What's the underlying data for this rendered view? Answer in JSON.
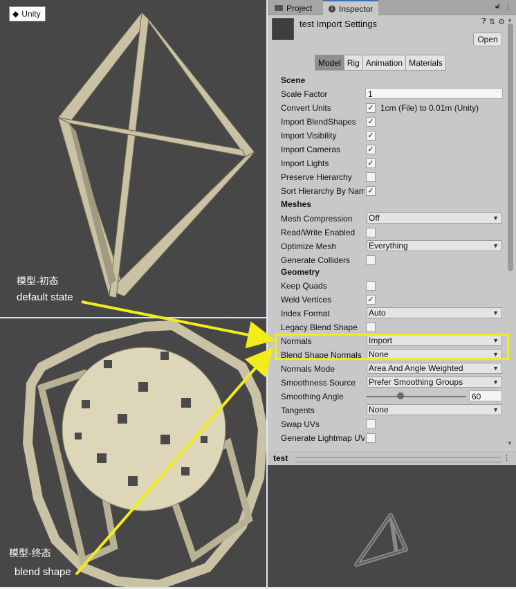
{
  "scene_view": {
    "badge": "Unity",
    "top_label_cn": "模型-初态",
    "top_label_en": "default state",
    "bottom_label_cn": "模型-终态",
    "bottom_label_en": "blend shape"
  },
  "tabs": [
    {
      "label": "Project",
      "icon": "folder-icon"
    },
    {
      "label": "Inspector",
      "icon": "info-icon"
    }
  ],
  "header": {
    "title": "test Import Settings",
    "open_label": "Open"
  },
  "subtabs": [
    "Model",
    "Rig",
    "Animation",
    "Materials"
  ],
  "scene": {
    "section": "Scene",
    "scale_factor_label": "Scale Factor",
    "scale_factor_value": "1",
    "convert_units_label": "Convert Units",
    "convert_units_text": "1cm (File) to 0.01m (Unity)",
    "import_blendshapes_label": "Import BlendShapes",
    "import_visibility_label": "Import Visibility",
    "import_cameras_label": "Import Cameras",
    "import_lights_label": "Import Lights",
    "preserve_hierarchy_label": "Preserve Hierarchy",
    "sort_hierarchy_label": "Sort Hierarchy By Name"
  },
  "meshes": {
    "section": "Meshes",
    "mesh_compression_label": "Mesh Compression",
    "mesh_compression_value": "Off",
    "read_write_label": "Read/Write Enabled",
    "optimize_mesh_label": "Optimize Mesh",
    "optimize_mesh_value": "Everything",
    "generate_colliders_label": "Generate Colliders"
  },
  "geometry": {
    "section": "Geometry",
    "keep_quads_label": "Keep Quads",
    "weld_vertices_label": "Weld Vertices",
    "index_format_label": "Index Format",
    "index_format_value": "Auto",
    "legacy_blend_label": "Legacy Blend Shape",
    "normals_label": "Normals",
    "normals_value": "Import",
    "blend_normals_label": "Blend Shape Normals",
    "blend_normals_value": "None",
    "normals_mode_label": "Normals Mode",
    "normals_mode_value": "Area And Angle Weighted",
    "smoothness_source_label": "Smoothness Source",
    "smoothness_source_value": "Prefer Smoothing Groups",
    "smoothing_angle_label": "Smoothing Angle",
    "smoothing_angle_value": "60",
    "tangents_label": "Tangents",
    "tangents_value": "None",
    "swap_uvs_label": "Swap UVs",
    "lightmap_uvs_label": "Generate Lightmap UVs"
  },
  "preview": {
    "title": "test"
  },
  "colors": {
    "annotation": "#f2ec1a",
    "viewport_bg": "#474747",
    "inspector_bg": "#c8c8c8"
  }
}
